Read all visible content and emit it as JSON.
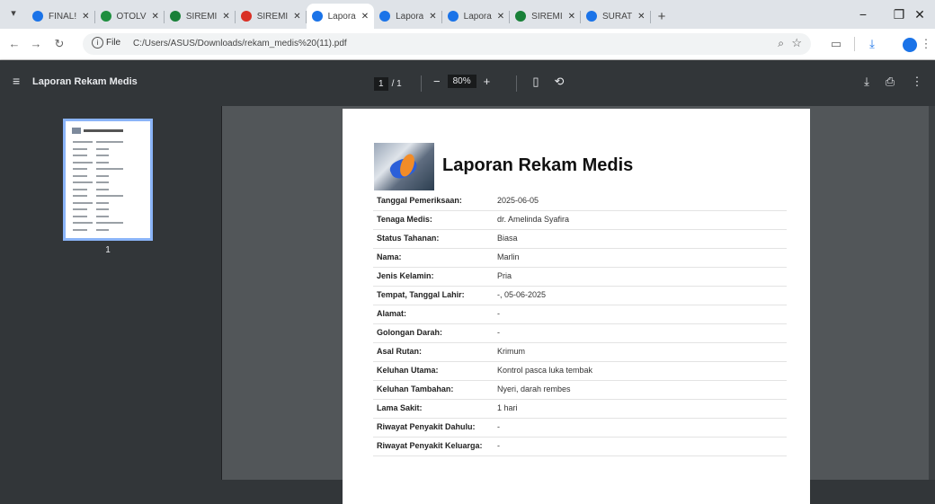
{
  "tabs": [
    {
      "title": "FINAL!",
      "color": "#1a73e8",
      "active": false
    },
    {
      "title": "OTOLV",
      "color": "#1e8e3e",
      "active": false
    },
    {
      "title": "SIREMI",
      "color": "#188038",
      "active": false
    },
    {
      "title": "SIREMI",
      "color": "#d93025",
      "active": false
    },
    {
      "title": "Lapora",
      "color": "#1a73e8",
      "active": true
    },
    {
      "title": "Lapora",
      "color": "#1a73e8",
      "active": false
    },
    {
      "title": "Lapora",
      "color": "#1a73e8",
      "active": false
    },
    {
      "title": "SIREMI",
      "color": "#188038",
      "active": false
    },
    {
      "title": "SURAT",
      "color": "#1a73e8",
      "active": false
    }
  ],
  "tab_close_glyph": "✕",
  "new_tab_glyph": "+",
  "window": {
    "minimize": "−",
    "maximize": "❐",
    "close": "✕"
  },
  "toolbar": {
    "back": "←",
    "forward": "→",
    "reload": "↻",
    "chip_label": "File",
    "url": "C:/Users/ASUS/Downloads/rekam_medis%20(11).pdf",
    "zoom_icon": "⌕",
    "bookmark_icon": "☆",
    "extensions_icon": "▭",
    "download_icon": "⤓",
    "profile_initial": "",
    "more_icon": "⋮"
  },
  "pdf_toolbar": {
    "menu_icon": "≡",
    "title": "Laporan Rekam Medis",
    "page_current": "1",
    "page_total": "/ 1",
    "zoom_out": "−",
    "zoom_value": "80%",
    "zoom_in": "+",
    "fit_icon": "▯",
    "rotate_icon": "⟲",
    "download_icon": "⤓",
    "print_icon": "⎙",
    "more_icon": "⋮"
  },
  "thumbnail": {
    "page_number": "1"
  },
  "document": {
    "heading": "Laporan Rekam Medis",
    "records": [
      {
        "label": "Tanggal Pemeriksaan:",
        "value": "2025-06-05"
      },
      {
        "label": "Tenaga Medis:",
        "value": "dr. Amelinda Syafira"
      },
      {
        "label": "Status Tahanan:",
        "value": "Biasa"
      },
      {
        "label": "Nama:",
        "value": "Marlin"
      },
      {
        "label": "Jenis Kelamin:",
        "value": "Pria"
      },
      {
        "label": "Tempat, Tanggal Lahir:",
        "value": "-, 05-06-2025"
      },
      {
        "label": "Alamat:",
        "value": "-"
      },
      {
        "label": "Golongan Darah:",
        "value": "-"
      },
      {
        "label": "Asal Rutan:",
        "value": "Krimum"
      },
      {
        "label": "Keluhan Utama:",
        "value": "Kontrol pasca luka tembak"
      },
      {
        "label": "Keluhan Tambahan:",
        "value": "Nyeri, darah rembes"
      },
      {
        "label": "Lama Sakit:",
        "value": "1 hari"
      },
      {
        "label": "Riwayat Penyakit Dahulu:",
        "value": "-"
      },
      {
        "label": "Riwayat Penyakit Keluarga:",
        "value": "-"
      }
    ]
  }
}
